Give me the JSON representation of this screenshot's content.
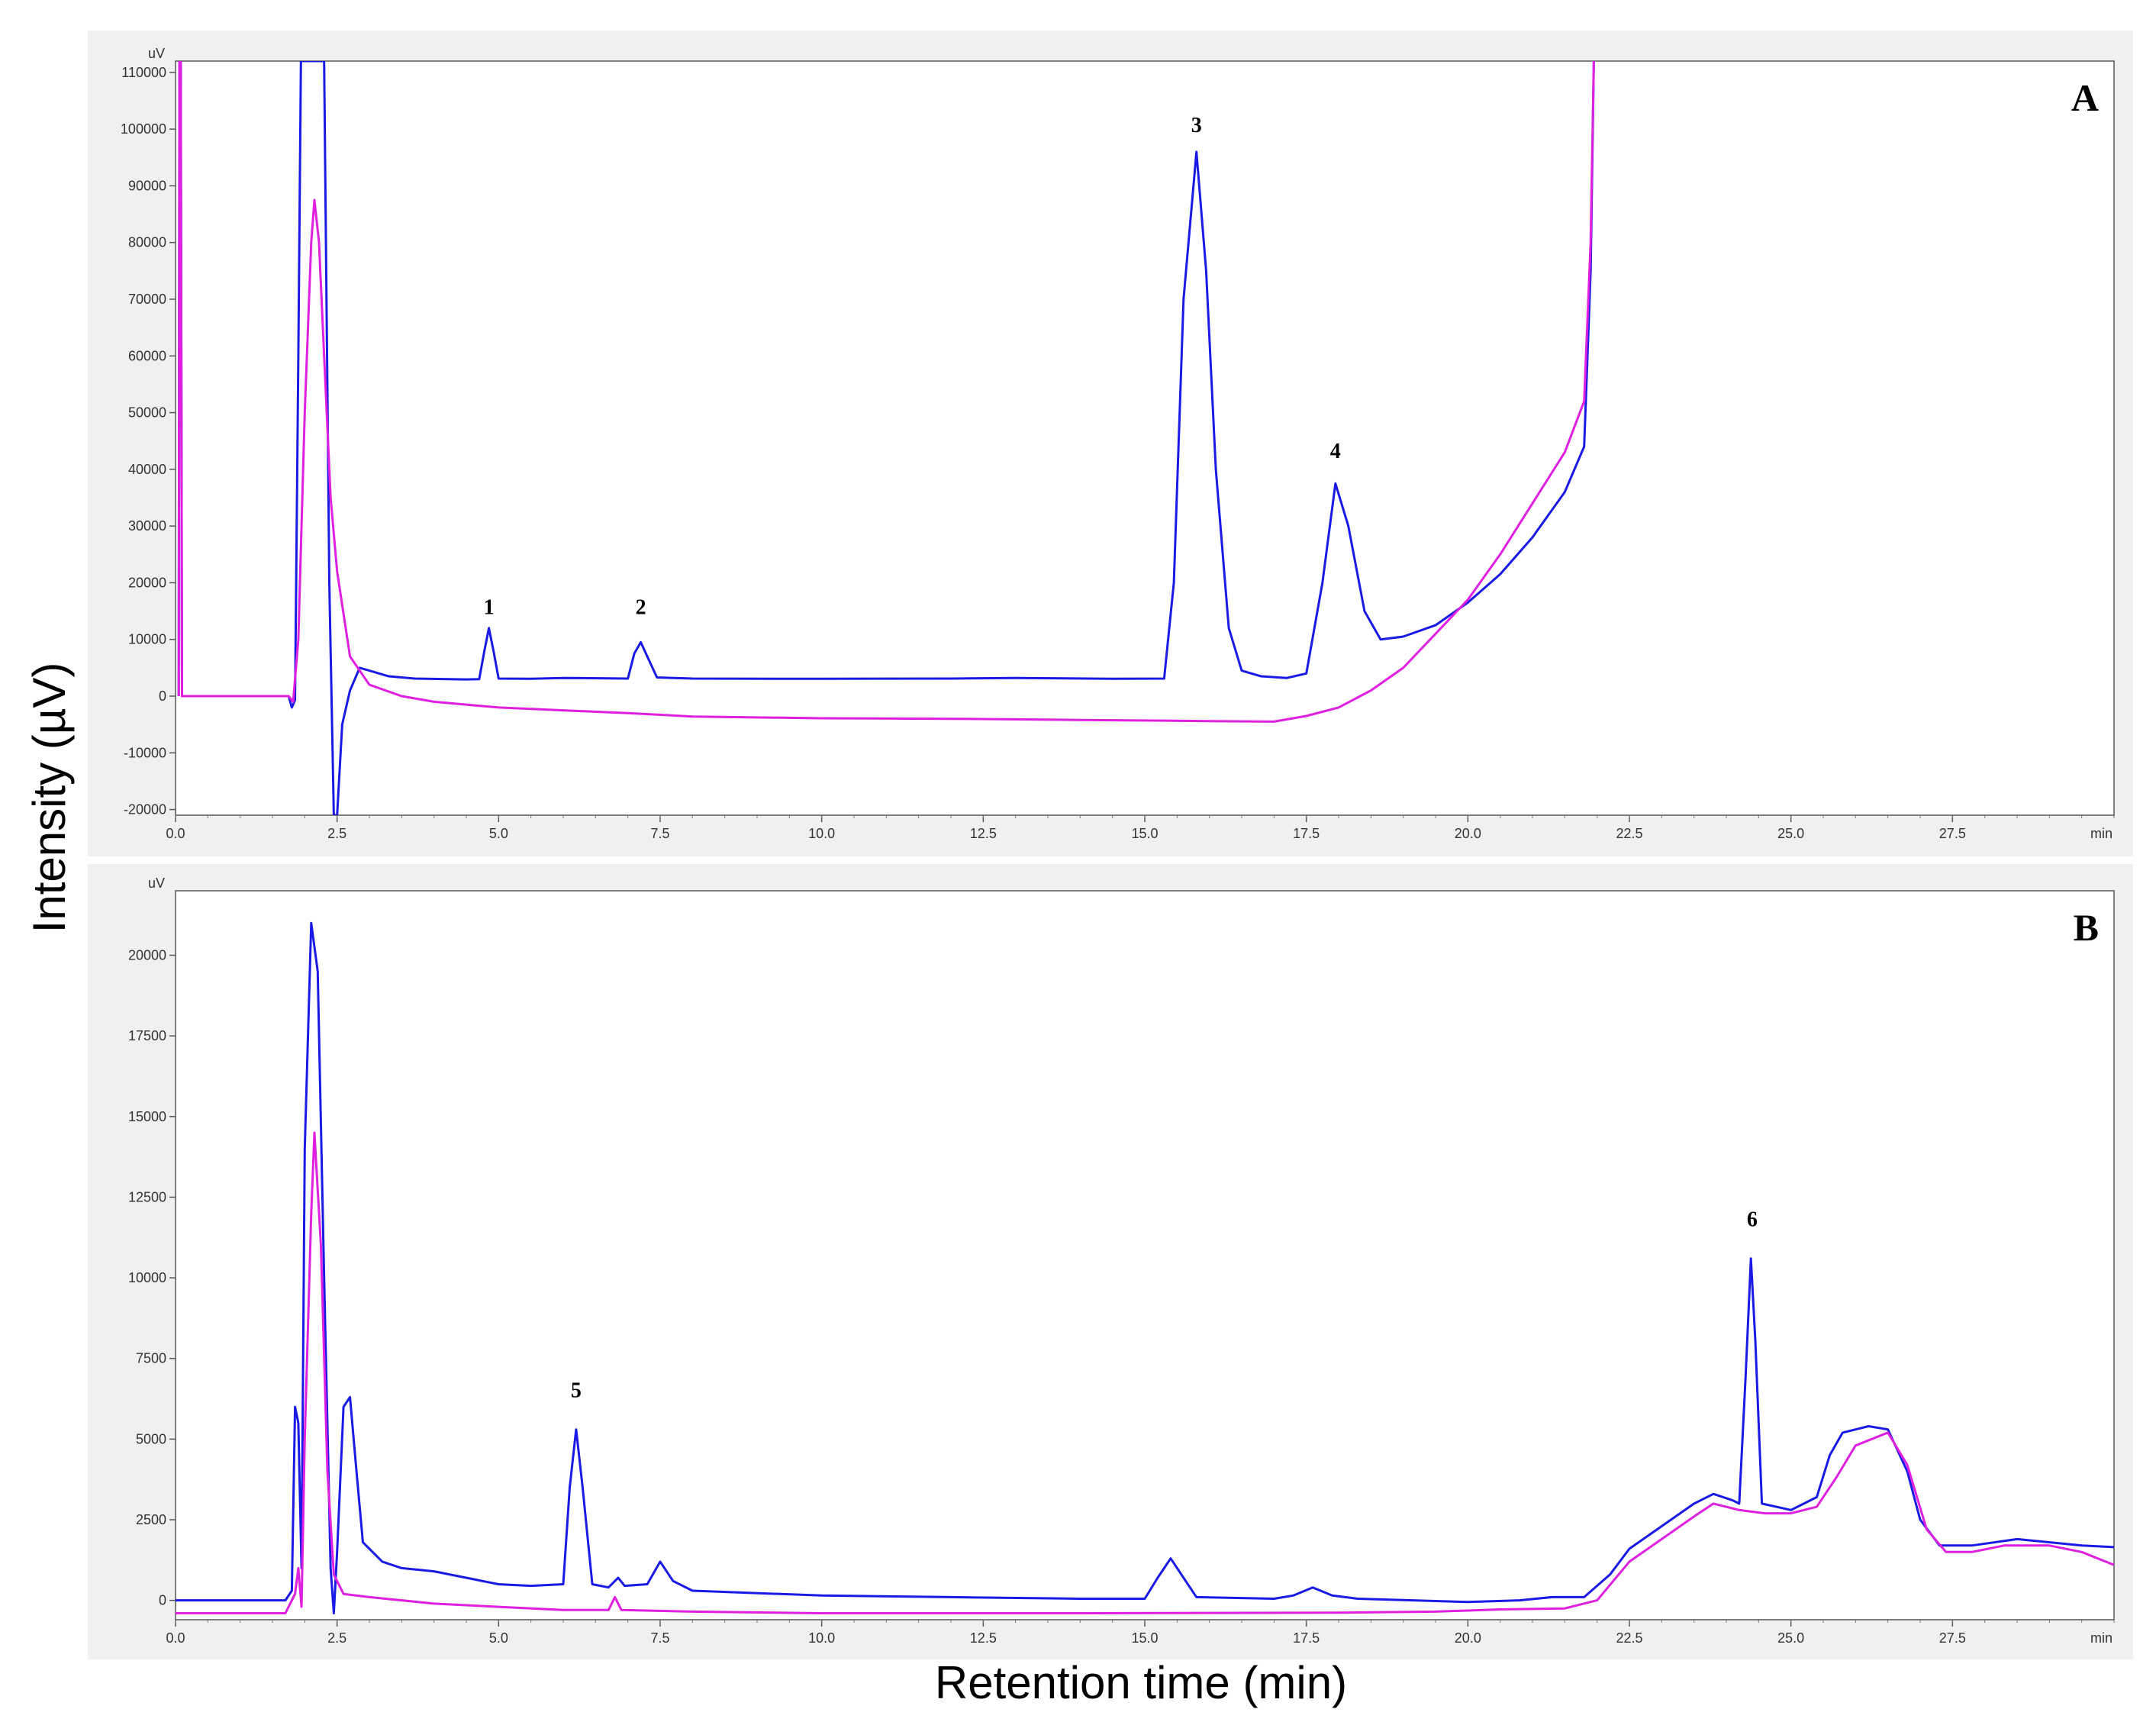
{
  "figure": {
    "ylabel": "Intensity (µV)",
    "xlabel": "Retention time (min)"
  },
  "colors": {
    "series_blue": "#1a1ae6",
    "series_magenta": "#e020e0",
    "panel_background": "#f0f0f0",
    "plot_background": "#ffffff"
  },
  "chart_data": [
    {
      "type": "line",
      "panel_label": "A",
      "y_unit": "uV",
      "x_unit": "min",
      "xlim": [
        0,
        30
      ],
      "ylim": [
        -21000,
        112000
      ],
      "x_ticks": [
        "0.0",
        "2.5",
        "5.0",
        "7.5",
        "10.0",
        "12.5",
        "15.0",
        "17.5",
        "20.0",
        "22.5",
        "25.0",
        "27.5"
      ],
      "y_ticks": [
        "110000",
        "100000",
        "90000",
        "80000",
        "70000",
        "60000",
        "50000",
        "40000",
        "30000",
        "20000",
        "10000",
        "0",
        "-10000",
        "-20000"
      ],
      "peaks": [
        {
          "label": "1",
          "x": 4.85,
          "y": 14500
        },
        {
          "label": "2",
          "x": 7.2,
          "y": 14500
        },
        {
          "label": "3",
          "x": 15.8,
          "y": 99500
        },
        {
          "label": "4",
          "x": 17.95,
          "y": 42000
        }
      ],
      "series": [
        {
          "color": "#1a1ae6",
          "points": [
            [
              0.05,
              0
            ],
            [
              0.06,
              112000
            ],
            [
              0.08,
              112000
            ],
            [
              0.1,
              0
            ],
            [
              1.5,
              0
            ],
            [
              1.75,
              0
            ],
            [
              1.8,
              -2000
            ],
            [
              1.85,
              -700
            ],
            [
              1.9,
              60000
            ],
            [
              1.94,
              112000
            ],
            [
              2.2,
              112000
            ],
            [
              2.3,
              112000
            ],
            [
              2.38,
              20000
            ],
            [
              2.45,
              -21000
            ],
            [
              2.5,
              -21000
            ],
            [
              2.58,
              -5000
            ],
            [
              2.7,
              1000
            ],
            [
              2.85,
              5000
            ],
            [
              3.0,
              4500
            ],
            [
              3.3,
              3500
            ],
            [
              3.7,
              3100
            ],
            [
              4.5,
              2950
            ],
            [
              4.7,
              3000
            ],
            [
              4.78,
              8000
            ],
            [
              4.85,
              12000
            ],
            [
              4.92,
              8000
            ],
            [
              5.0,
              3100
            ],
            [
              5.5,
              3050
            ],
            [
              6.0,
              3200
            ],
            [
              7.0,
              3100
            ],
            [
              7.1,
              7500
            ],
            [
              7.2,
              9500
            ],
            [
              7.3,
              7000
            ],
            [
              7.45,
              3300
            ],
            [
              8.0,
              3100
            ],
            [
              10.0,
              3050
            ],
            [
              12.0,
              3100
            ],
            [
              13.0,
              3200
            ],
            [
              14.5,
              3050
            ],
            [
              15.3,
              3100
            ],
            [
              15.45,
              20000
            ],
            [
              15.6,
              70000
            ],
            [
              15.8,
              96000
            ],
            [
              15.95,
              75000
            ],
            [
              16.1,
              40000
            ],
            [
              16.3,
              12000
            ],
            [
              16.5,
              4500
            ],
            [
              16.8,
              3500
            ],
            [
              17.2,
              3200
            ],
            [
              17.5,
              4000
            ],
            [
              17.75,
              20000
            ],
            [
              17.95,
              37500
            ],
            [
              18.15,
              30000
            ],
            [
              18.4,
              15000
            ],
            [
              18.65,
              10000
            ],
            [
              19.0,
              10500
            ],
            [
              19.5,
              12500
            ],
            [
              20.0,
              16500
            ],
            [
              20.5,
              21500
            ],
            [
              21.0,
              28000
            ],
            [
              21.5,
              36000
            ],
            [
              21.8,
              44000
            ],
            [
              21.9,
              75000
            ],
            [
              21.95,
              112000
            ]
          ]
        },
        {
          "color": "#e020e0",
          "points": [
            [
              0.05,
              0
            ],
            [
              0.06,
              112000
            ],
            [
              0.08,
              112000
            ],
            [
              0.1,
              0
            ],
            [
              1.5,
              0
            ],
            [
              1.75,
              0
            ],
            [
              1.82,
              -1000
            ],
            [
              1.9,
              10000
            ],
            [
              2.0,
              50000
            ],
            [
              2.1,
              80000
            ],
            [
              2.15,
              87500
            ],
            [
              2.22,
              80000
            ],
            [
              2.3,
              60000
            ],
            [
              2.4,
              35000
            ],
            [
              2.5,
              22000
            ],
            [
              2.7,
              7000
            ],
            [
              3.0,
              2000
            ],
            [
              3.5,
              0
            ],
            [
              4.0,
              -1000
            ],
            [
              5.0,
              -2000
            ],
            [
              6.0,
              -2500
            ],
            [
              7.0,
              -3000
            ],
            [
              8.0,
              -3600
            ],
            [
              10.0,
              -3900
            ],
            [
              12.0,
              -4000
            ],
            [
              14.0,
              -4200
            ],
            [
              16.0,
              -4400
            ],
            [
              17.0,
              -4500
            ],
            [
              17.5,
              -3500
            ],
            [
              18.0,
              -2000
            ],
            [
              18.5,
              1000
            ],
            [
              19.0,
              5000
            ],
            [
              19.5,
              11000
            ],
            [
              20.0,
              17000
            ],
            [
              20.5,
              25000
            ],
            [
              21.0,
              34000
            ],
            [
              21.5,
              43000
            ],
            [
              21.8,
              52000
            ],
            [
              21.9,
              80000
            ],
            [
              21.95,
              112000
            ]
          ]
        }
      ]
    },
    {
      "type": "line",
      "panel_label": "B",
      "y_unit": "uV",
      "x_unit": "min",
      "xlim": [
        0,
        30
      ],
      "ylim": [
        -600,
        22000
      ],
      "x_ticks": [
        "0.0",
        "2.5",
        "5.0",
        "7.5",
        "10.0",
        "12.5",
        "15.0",
        "17.5",
        "20.0",
        "22.5",
        "25.0",
        "27.5"
      ],
      "y_ticks": [
        "20000",
        "17500",
        "15000",
        "12500",
        "10000",
        "7500",
        "5000",
        "2500",
        "0"
      ],
      "peaks": [
        {
          "label": "5",
          "x": 6.2,
          "y": 6300
        },
        {
          "label": "6",
          "x": 24.4,
          "y": 11600
        }
      ],
      "series": [
        {
          "color": "#1a1ae6",
          "points": [
            [
              0.0,
              0
            ],
            [
              1.7,
              0
            ],
            [
              1.8,
              300
            ],
            [
              1.85,
              6000
            ],
            [
              1.9,
              5500
            ],
            [
              1.95,
              1000
            ],
            [
              2.0,
              14000
            ],
            [
              2.1,
              21000
            ],
            [
              2.2,
              19500
            ],
            [
              2.3,
              10000
            ],
            [
              2.4,
              1000
            ],
            [
              2.45,
              -400
            ],
            [
              2.5,
              1500
            ],
            [
              2.6,
              6000
            ],
            [
              2.7,
              6300
            ],
            [
              2.8,
              4000
            ],
            [
              2.9,
              1800
            ],
            [
              3.2,
              1200
            ],
            [
              3.5,
              1000
            ],
            [
              4.0,
              900
            ],
            [
              5.0,
              500
            ],
            [
              5.5,
              450
            ],
            [
              6.0,
              500
            ],
            [
              6.1,
              3500
            ],
            [
              6.2,
              5300
            ],
            [
              6.3,
              3500
            ],
            [
              6.45,
              500
            ],
            [
              6.7,
              400
            ],
            [
              6.85,
              700
            ],
            [
              6.95,
              450
            ],
            [
              7.3,
              500
            ],
            [
              7.5,
              1200
            ],
            [
              7.7,
              600
            ],
            [
              8.0,
              300
            ],
            [
              10.0,
              150
            ],
            [
              12.0,
              100
            ],
            [
              14.0,
              50
            ],
            [
              15.0,
              50
            ],
            [
              15.2,
              700
            ],
            [
              15.4,
              1300
            ],
            [
              15.6,
              700
            ],
            [
              15.8,
              100
            ],
            [
              17.0,
              50
            ],
            [
              17.3,
              150
            ],
            [
              17.6,
              400
            ],
            [
              17.9,
              150
            ],
            [
              18.3,
              50
            ],
            [
              20.0,
              -50
            ],
            [
              20.8,
              0
            ],
            [
              21.3,
              100
            ],
            [
              21.8,
              100
            ],
            [
              22.2,
              800
            ],
            [
              22.5,
              1600
            ],
            [
              23.0,
              2300
            ],
            [
              23.5,
              3000
            ],
            [
              23.8,
              3300
            ],
            [
              24.1,
              3100
            ],
            [
              24.2,
              3000
            ],
            [
              24.3,
              7000
            ],
            [
              24.38,
              10600
            ],
            [
              24.45,
              8000
            ],
            [
              24.55,
              3000
            ],
            [
              25.0,
              2800
            ],
            [
              25.2,
              3000
            ],
            [
              25.4,
              3200
            ],
            [
              25.6,
              4500
            ],
            [
              25.8,
              5200
            ],
            [
              26.2,
              5400
            ],
            [
              26.5,
              5300
            ],
            [
              26.8,
              4000
            ],
            [
              27.0,
              2500
            ],
            [
              27.3,
              1700
            ],
            [
              27.8,
              1700
            ],
            [
              28.5,
              1900
            ],
            [
              29.5,
              1700
            ],
            [
              30.0,
              1650
            ]
          ]
        },
        {
          "color": "#e020e0",
          "points": [
            [
              0.0,
              -400
            ],
            [
              1.7,
              -400
            ],
            [
              1.85,
              200
            ],
            [
              1.9,
              1000
            ],
            [
              1.95,
              -200
            ],
            [
              2.0,
              5000
            ],
            [
              2.1,
              12000
            ],
            [
              2.15,
              14500
            ],
            [
              2.25,
              11000
            ],
            [
              2.35,
              4000
            ],
            [
              2.45,
              800
            ],
            [
              2.6,
              200
            ],
            [
              3.0,
              100
            ],
            [
              4.0,
              -100
            ],
            [
              5.0,
              -200
            ],
            [
              6.0,
              -300
            ],
            [
              6.7,
              -300
            ],
            [
              6.8,
              100
            ],
            [
              6.9,
              -300
            ],
            [
              8.0,
              -350
            ],
            [
              10.0,
              -400
            ],
            [
              14.0,
              -400
            ],
            [
              18.0,
              -380
            ],
            [
              19.5,
              -350
            ],
            [
              20.5,
              -280
            ],
            [
              21.5,
              -250
            ],
            [
              22.0,
              0
            ],
            [
              22.5,
              1200
            ],
            [
              23.0,
              1900
            ],
            [
              23.5,
              2600
            ],
            [
              23.8,
              3000
            ],
            [
              24.2,
              2800
            ],
            [
              24.6,
              2700
            ],
            [
              25.0,
              2700
            ],
            [
              25.4,
              2900
            ],
            [
              25.7,
              3800
            ],
            [
              26.0,
              4800
            ],
            [
              26.5,
              5200
            ],
            [
              26.8,
              4200
            ],
            [
              27.1,
              2200
            ],
            [
              27.4,
              1500
            ],
            [
              27.8,
              1500
            ],
            [
              28.3,
              1700
            ],
            [
              29.0,
              1700
            ],
            [
              29.5,
              1500
            ],
            [
              30.0,
              1100
            ]
          ]
        }
      ]
    }
  ]
}
